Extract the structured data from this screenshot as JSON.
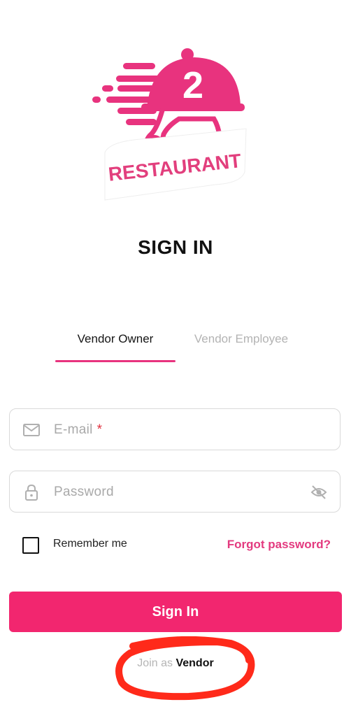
{
  "logo": {
    "number": "2",
    "word": "RESTAURANT"
  },
  "page": {
    "title": "SIGN IN"
  },
  "tabs": [
    {
      "label": "Vendor Owner",
      "active": true
    },
    {
      "label": "Vendor Employee",
      "active": false
    }
  ],
  "form": {
    "email": {
      "placeholder": "E-mail",
      "required_mark": "*",
      "value": ""
    },
    "password": {
      "placeholder": "Password",
      "value": ""
    },
    "remember": {
      "label": "Remember me",
      "checked": false
    },
    "forgot_label": "Forgot password?",
    "submit_label": "Sign In"
  },
  "footer": {
    "prefix": "Join as",
    "link_label": "Vendor"
  },
  "icons": {
    "email": "mail-icon",
    "password": "lock-icon",
    "toggle": "eye-off-icon"
  },
  "colors": {
    "accent": "#f2266f",
    "brand": "#e8337e",
    "annotation": "#ff2a1a"
  }
}
